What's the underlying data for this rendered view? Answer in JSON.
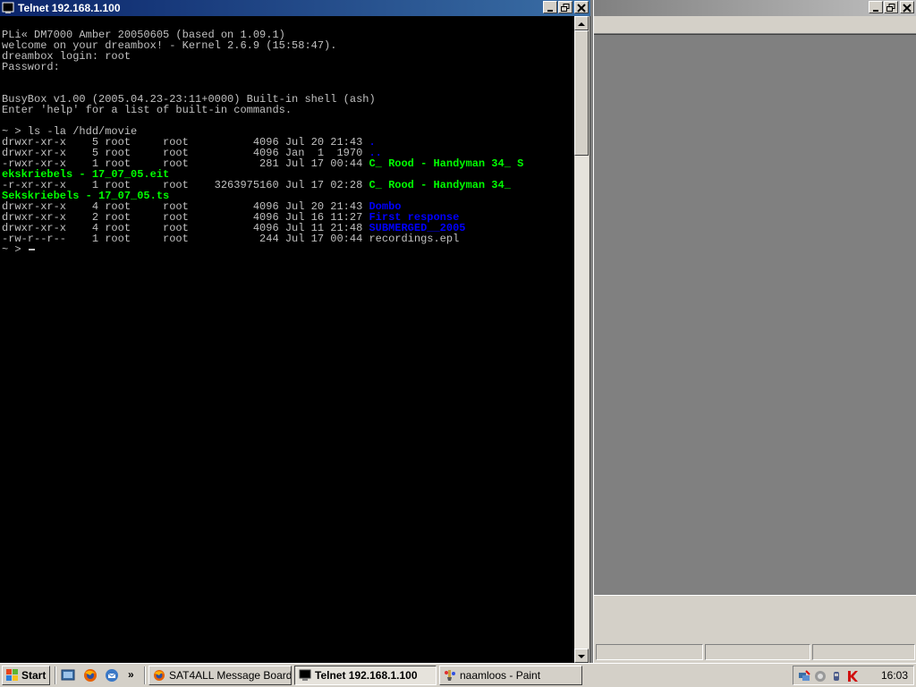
{
  "telnet_window": {
    "title": "Telnet 192.168.1.100",
    "terminal_lines": [
      {
        "text": "PLi« DM7000 Amber 20050605 (based on 1.09.1)",
        "color": "#c0c0c0",
        "bold": false
      },
      {
        "text": "welcome on your dreambox! - Kernel 2.6.9 (15:58:47).",
        "color": "#c0c0c0",
        "bold": false
      },
      {
        "text": "dreambox login: root",
        "color": "#c0c0c0",
        "bold": false
      },
      {
        "text": "Password:",
        "color": "#c0c0c0",
        "bold": false
      },
      {
        "text": "",
        "color": "#c0c0c0",
        "bold": false
      },
      {
        "text": "",
        "color": "#c0c0c0",
        "bold": false
      },
      {
        "text": "BusyBox v1.00 (2005.04.23-23:11+0000) Built-in shell (ash)",
        "color": "#c0c0c0",
        "bold": false
      },
      {
        "text": "Enter 'help' for a list of built-in commands.",
        "color": "#c0c0c0",
        "bold": false
      },
      {
        "text": "",
        "color": "#c0c0c0",
        "bold": false
      },
      {
        "text": "~ > ls -la /hdd/movie",
        "color": "#c0c0c0",
        "bold": false
      },
      {
        "text": "drwxr-xr-x    5 root     root          4096 Jul 20 21:43 ",
        "suffix": ".",
        "suffix_color": "#0000ff",
        "color": "#c0c0c0",
        "bold": false
      },
      {
        "text": "drwxr-xr-x    5 root     root          4096 Jan  1  1970 ",
        "suffix": "..",
        "suffix_color": "#0000ff",
        "color": "#c0c0c0",
        "bold": false
      },
      {
        "text": "-rwxr-xr-x    1 root     root           281 Jul 17 00:44 ",
        "suffix": "C_ Rood - Handyman 34_ S",
        "suffix_color": "#00ff00",
        "color": "#c0c0c0",
        "bold": false
      },
      {
        "text": "ekskriebels - 17_07_05.eit",
        "color": "#00ff00",
        "bold": true
      },
      {
        "text": "-r-xr-xr-x    1 root     root    3263975160 Jul 17 02:28 ",
        "suffix": "C_ Rood - Handyman 34_",
        "suffix_color": "#00ff00",
        "color": "#c0c0c0",
        "bold": false
      },
      {
        "text": "Sekskriebels - 17_07_05.ts",
        "color": "#00ff00",
        "bold": true
      },
      {
        "text": "drwxr-xr-x    4 root     root          4096 Jul 20 21:43 ",
        "suffix": "Dombo",
        "suffix_color": "#0000ff",
        "color": "#c0c0c0",
        "bold": false
      },
      {
        "text": "drwxr-xr-x    2 root     root          4096 Jul 16 11:27 ",
        "suffix": "First response",
        "suffix_color": "#0000ff",
        "color": "#c0c0c0",
        "bold": false
      },
      {
        "text": "drwxr-xr-x    4 root     root          4096 Jul 11 21:48 ",
        "suffix": "SUBMERGED__2005",
        "suffix_color": "#0000ff",
        "color": "#c0c0c0",
        "bold": false
      },
      {
        "text": "-rw-r--r--    1 root     root           244 Jul 17 00:44 recordings.epl",
        "color": "#c0c0c0",
        "bold": false
      },
      {
        "text": "~ > ",
        "color": "#c0c0c0",
        "bold": false,
        "cursor": true
      }
    ]
  },
  "taskbar": {
    "start_label": "Start",
    "quick_launch_more": "»",
    "tasks": [
      {
        "label": "SAT4ALL Message Board...",
        "icon": "firefox-icon",
        "active": false
      },
      {
        "label": "Telnet 192.168.1.100",
        "icon": "telnet-icon",
        "active": true
      },
      {
        "label": "naamloos - Paint",
        "icon": "paint-icon",
        "active": false
      }
    ],
    "tray_icons": [
      "network-icon",
      "volume-icon",
      "usb-icon",
      "antivirus-icon"
    ],
    "clock": "16:03"
  },
  "colors": {
    "titlebar_active": "#0a246a",
    "terminal_bg": "#000000",
    "terminal_text": "#c0c0c0",
    "dir_blue": "#0000ff",
    "file_green": "#00ff00"
  }
}
